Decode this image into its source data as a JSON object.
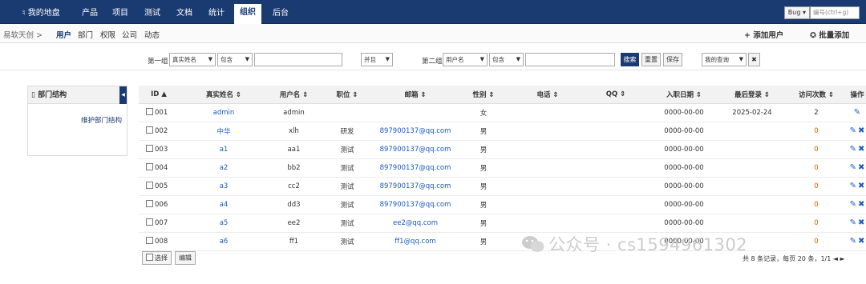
{
  "topnav": {
    "tabs": [
      {
        "label": "♮ 我的地盘",
        "active": false
      },
      {
        "label": "产品",
        "active": false
      },
      {
        "label": "项目",
        "active": false
      },
      {
        "label": "测试",
        "active": false
      },
      {
        "label": "文档",
        "active": false
      },
      {
        "label": "统计",
        "active": false
      },
      {
        "label": "组织",
        "active": true
      },
      {
        "label": "后台",
        "active": false
      }
    ],
    "bug_select": "Bug",
    "bug_placeholder": "编号(ctrl+g)"
  },
  "subnav": {
    "crumb": "易软天创 >",
    "items": [
      {
        "label": "用户",
        "active": true
      },
      {
        "label": "部门",
        "active": false
      },
      {
        "label": "权限",
        "active": false
      },
      {
        "label": "公司",
        "active": false
      },
      {
        "label": "动态",
        "active": false
      }
    ],
    "add_user": "+ 添加用户",
    "batch_add": "✪ 批量添加"
  },
  "search": {
    "group1_label": "第一组",
    "field1": "真实姓名",
    "op1": "包含",
    "value1": "",
    "andor": "并且",
    "group2_label": "第二组",
    "field2": "用户名",
    "op2": "包含",
    "value2": "",
    "search_btn": "搜索",
    "reset_btn": "重置",
    "save_btn": "保存",
    "my_query": "我的查询"
  },
  "leftpanel": {
    "title": "部门结构",
    "link": "维护部门结构"
  },
  "table": {
    "headers": [
      "ID ▲",
      "真实姓名 ⇕",
      "用户名 ⇕",
      "职位 ⇕",
      "邮箱 ⇕",
      "性别 ⇕",
      "电话 ⇕",
      "QQ ⇕",
      "入职日期 ⇕",
      "最后登录 ⇕",
      "访问次数 ⇕",
      "操作"
    ],
    "rows": [
      {
        "id": "001",
        "realname": "admin",
        "username": "admin",
        "role": "",
        "email": "",
        "gender": "女",
        "phone": "",
        "qq": "",
        "join": "0000-00-00",
        "last": "2025-02-24",
        "visits": "2"
      },
      {
        "id": "002",
        "realname": "中华",
        "username": "xlh",
        "role": "研发",
        "email": "897900137@qq.com",
        "gender": "男",
        "phone": "",
        "qq": "",
        "join": "0000-00-00",
        "last": "",
        "visits": "0"
      },
      {
        "id": "003",
        "realname": "a1",
        "username": "aa1",
        "role": "测试",
        "email": "897900137@qq.com",
        "gender": "男",
        "phone": "",
        "qq": "",
        "join": "0000-00-00",
        "last": "",
        "visits": "0"
      },
      {
        "id": "004",
        "realname": "a2",
        "username": "bb2",
        "role": "测试",
        "email": "897900137@qq.com",
        "gender": "男",
        "phone": "",
        "qq": "",
        "join": "0000-00-00",
        "last": "",
        "visits": "0"
      },
      {
        "id": "005",
        "realname": "a3",
        "username": "cc2",
        "role": "测试",
        "email": "897900137@qq.com",
        "gender": "男",
        "phone": "",
        "qq": "",
        "join": "0000-00-00",
        "last": "",
        "visits": "0"
      },
      {
        "id": "006",
        "realname": "a4",
        "username": "dd3",
        "role": "测试",
        "email": "897900137@qq.com",
        "gender": "男",
        "phone": "",
        "qq": "",
        "join": "0000-00-00",
        "last": "",
        "visits": "0"
      },
      {
        "id": "007",
        "realname": "a5",
        "username": "ee2",
        "role": "测试",
        "email": "ee2@qq.com",
        "gender": "男",
        "phone": "",
        "qq": "",
        "join": "0000-00-00",
        "last": "",
        "visits": "0"
      },
      {
        "id": "008",
        "realname": "a6",
        "username": "ff1",
        "role": "测试",
        "email": "ff1@qq.com",
        "gender": "男",
        "phone": "",
        "qq": "",
        "join": "0000-00-00",
        "last": "",
        "visits": "0"
      }
    ]
  },
  "footer": {
    "select_label": "选择",
    "edit_label": "编辑",
    "pager": "共 8 条记录，每页 20 条，1/1 ◄ ►"
  },
  "watermark": "公众号 · cs1594961302"
}
